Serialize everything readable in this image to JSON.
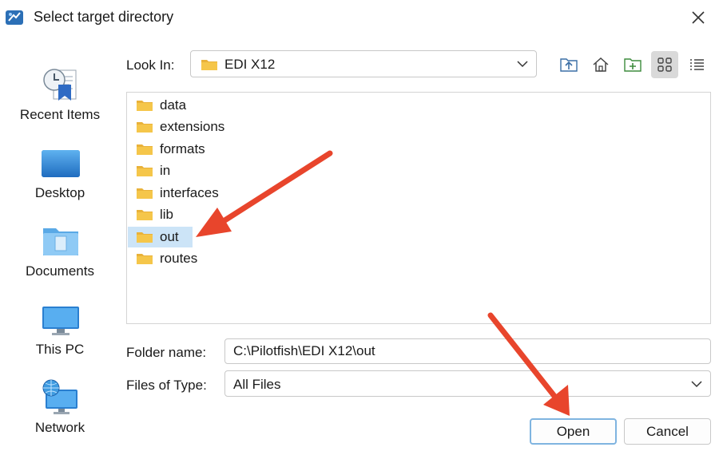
{
  "window": {
    "title": "Select target directory"
  },
  "sidebar": {
    "items": [
      {
        "label": "Recent Items"
      },
      {
        "label": "Desktop"
      },
      {
        "label": "Documents"
      },
      {
        "label": "This PC"
      },
      {
        "label": "Network"
      }
    ]
  },
  "lookin": {
    "label": "Look In:",
    "value": "EDI X12"
  },
  "files": {
    "items": [
      {
        "name": "data"
      },
      {
        "name": "extensions"
      },
      {
        "name": "formats"
      },
      {
        "name": "in"
      },
      {
        "name": "interfaces"
      },
      {
        "name": "lib"
      },
      {
        "name": "out",
        "selected": true
      },
      {
        "name": "routes"
      }
    ]
  },
  "folder_name": {
    "label": "Folder name:",
    "value": "C:\\Pilotfish\\EDI X12\\out"
  },
  "files_of_type": {
    "label": "Files of Type:",
    "value": "All Files"
  },
  "buttons": {
    "open": "Open",
    "cancel": "Cancel"
  },
  "colors": {
    "folder": "#f5c64a",
    "selection": "#cce4f7",
    "annotation_arrow": "#e8452c",
    "open_border": "#7fb4e0"
  },
  "icons": [
    "app-icon",
    "close-icon",
    "recent-items-icon",
    "desktop-icon",
    "documents-icon",
    "this-pc-icon",
    "network-icon",
    "folder-icon",
    "chevron-down-icon",
    "up-folder-icon",
    "home-icon",
    "new-folder-icon",
    "grid-view-icon",
    "list-view-icon"
  ]
}
